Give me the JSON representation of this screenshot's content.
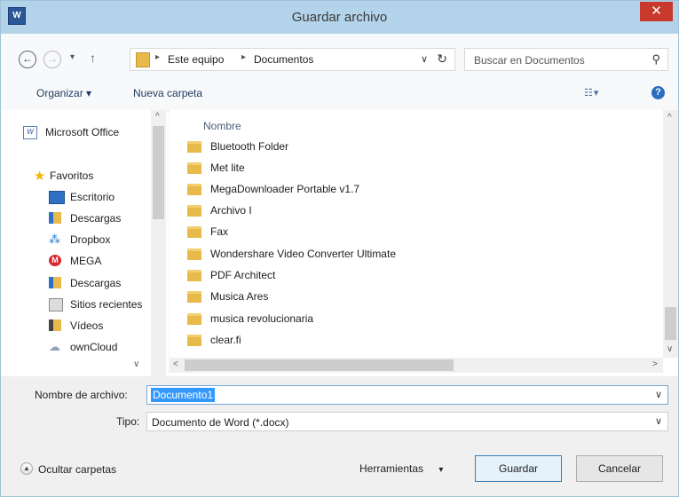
{
  "window": {
    "title": "Guardar archivo",
    "app_icon_glyph": "W",
    "close_glyph": "✕"
  },
  "address_bar": {
    "back_glyph": "←",
    "forward_glyph": "→",
    "recent_glyph": "▾",
    "up_glyph": "↑",
    "breadcrumb": [
      "Este equipo",
      "Documentos"
    ],
    "sep_glyph": "▸",
    "dropdown_glyph": "∨",
    "refresh_glyph": "↻",
    "search_placeholder": "Buscar en Documentos",
    "search_glyph": "⚲"
  },
  "command_bar": {
    "organize_label": "Organizar ▾",
    "new_folder_label": "Nueva carpeta",
    "view_glyph": "☷ ▾",
    "help_glyph": "?"
  },
  "nav_pane": {
    "items": [
      {
        "label": "Microsoft Office",
        "icon": "office-icon"
      },
      {
        "label": "Favoritos",
        "icon": "star-icon"
      },
      {
        "label": "Escritorio",
        "icon": "desktop-icon"
      },
      {
        "label": "Descargas",
        "icon": "downloads-icon"
      },
      {
        "label": "Dropbox",
        "icon": "dropbox-icon"
      },
      {
        "label": "MEGA",
        "icon": "mega-icon"
      },
      {
        "label": "Descargas",
        "icon": "downloads-icon"
      },
      {
        "label": "Sitios recientes",
        "icon": "recent-icon"
      },
      {
        "label": "Vídeos",
        "icon": "videos-icon"
      },
      {
        "label": "ownCloud",
        "icon": "cloud-icon"
      }
    ],
    "scroll_up_glyph": "^",
    "scroll_down_glyph": "∨"
  },
  "file_list": {
    "column_header": "Nombre",
    "files": [
      "Bluetooth Folder",
      "Met lite",
      "MegaDownloader Portable v1.7",
      "Archivo I",
      "Fax",
      "Wondershare Video Converter Ultimate",
      "PDF Architect",
      "Musica Ares",
      "musica revolucionaria",
      "clear.fi"
    ],
    "scroll_left_glyph": "<",
    "scroll_right_glyph": ">"
  },
  "form": {
    "filename_label": "Nombre de archivo:",
    "filename_value": "Documento1",
    "type_label": "Tipo:",
    "type_value": "Documento de Word (*.docx)",
    "dropdown_glyph": "∨"
  },
  "footer": {
    "hide_folders_label": "Ocultar carpetas",
    "hide_glyph": "▲",
    "tools_label": "Herramientas",
    "tools_glyph": "▾",
    "save_label": "Guardar",
    "cancel_label": "Cancelar"
  }
}
